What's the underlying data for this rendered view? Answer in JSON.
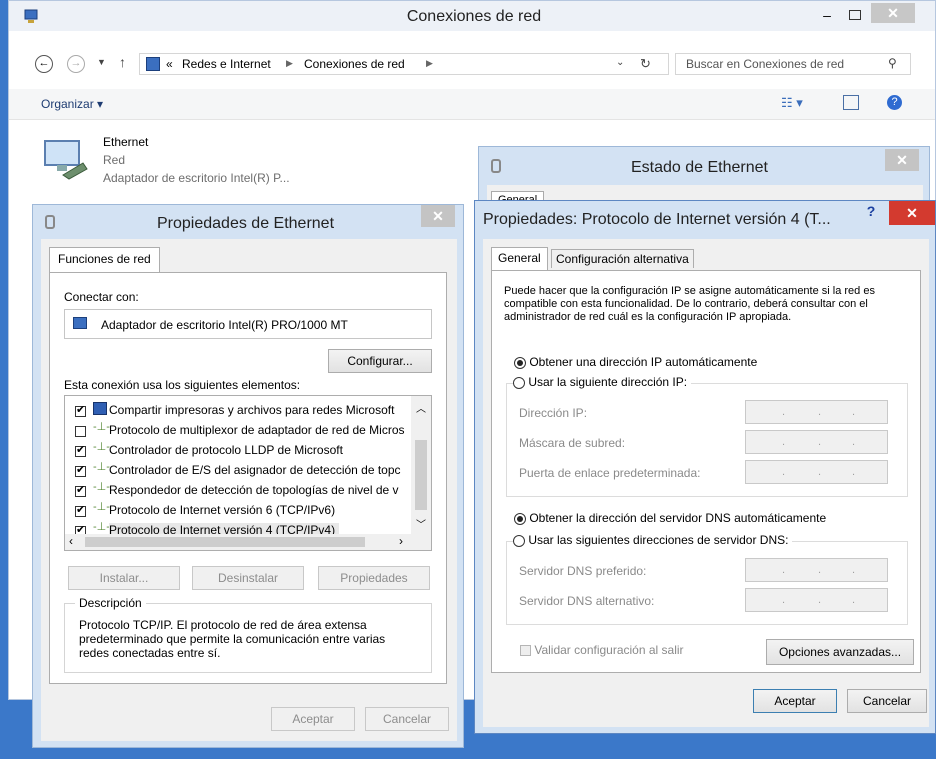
{
  "explorer": {
    "title": "Conexiones de red",
    "breadcrumb_prefix": "«",
    "breadcrumb": [
      "Redes e Internet",
      "Conexiones de red"
    ],
    "search_placeholder": "Buscar en Conexiones de red",
    "organize_label": "Organizar ▾",
    "adapter": {
      "name": "Ethernet",
      "status": "Red",
      "device": "Adaptador de escritorio Intel(R) P..."
    }
  },
  "status_window": {
    "title": "Estado de Ethernet",
    "tab": "General"
  },
  "props_window": {
    "title": "Propiedades de Ethernet",
    "tab": "Funciones de red",
    "connect_with_label": "Conectar con:",
    "adapter_name": "Adaptador de escritorio Intel(R) PRO/1000 MT",
    "configure_label": "Configurar...",
    "items_label": "Esta conexión usa los siguientes elementos:",
    "items": [
      {
        "label": "Compartir impresoras y archivos para redes Microsoft",
        "checked": true
      },
      {
        "label": "Protocolo de multiplexor de adaptador de red de Micros",
        "checked": false
      },
      {
        "label": "Controlador de protocolo LLDP de Microsoft",
        "checked": true
      },
      {
        "label": "Controlador de E/S del asignador de detección de topc",
        "checked": true
      },
      {
        "label": "Respondedor de detección de topologías de nivel de v",
        "checked": true
      },
      {
        "label": "Protocolo de Internet versión 6 (TCP/IPv6)",
        "checked": true
      },
      {
        "label": "Protocolo de Internet versión 4 (TCP/IPv4)",
        "checked": true
      }
    ],
    "install_label": "Instalar...",
    "uninstall_label": "Desinstalar",
    "properties_label": "Propiedades",
    "description_label": "Descripción",
    "description_text": "Protocolo TCP/IP. El protocolo de red de área extensa predeterminado que permite la comunicación entre varias redes conectadas entre sí.",
    "ok_label": "Aceptar",
    "cancel_label": "Cancelar"
  },
  "ipv4_window": {
    "title": "Propiedades: Protocolo de Internet versión 4 (T...",
    "help": "?",
    "tab_general": "General",
    "tab_alt": "Configuración alternativa",
    "intro": "Puede hacer que la configuración IP se asigne automáticamente si la red es compatible con esta funcionalidad. De lo contrario, deberá consultar con el administrador de red cuál es la configuración IP apropiada.",
    "ip_auto_label": "Obtener una dirección IP automáticamente",
    "ip_manual_label": "Usar la siguiente dirección IP:",
    "ip_address_label": "Dirección IP:",
    "subnet_label": "Máscara de subred:",
    "gateway_label": "Puerta de enlace predeterminada:",
    "dns_auto_label": "Obtener la dirección del servidor DNS automáticamente",
    "dns_manual_label": "Usar las siguientes direcciones de servidor DNS:",
    "dns_pref_label": "Servidor DNS preferido:",
    "dns_alt_label": "Servidor DNS alternativo:",
    "validate_label": "Validar configuración al salir",
    "advanced_label": "Opciones avanzadas...",
    "ok_label": "Aceptar",
    "cancel_label": "Cancelar"
  }
}
